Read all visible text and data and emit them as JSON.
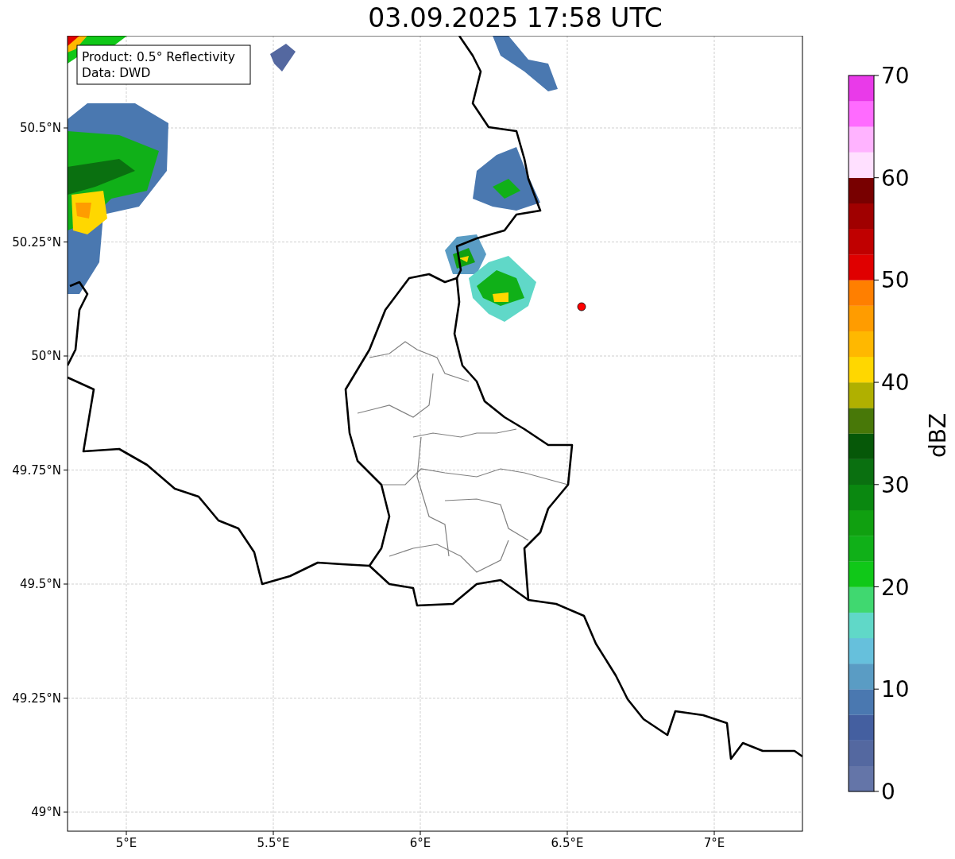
{
  "title": "03.09.2025 17:58 UTC",
  "info_box": [
    "Product: 0.5° Reflectivity",
    "Data: DWD"
  ],
  "x_tick_labels": [
    "5°E",
    "5.5°E",
    "6°E",
    "6.5°E",
    "7°E"
  ],
  "y_tick_labels": [
    "50.5°N",
    "50.25°N",
    "50°N",
    "49.75°N",
    "49.5°N",
    "49.25°N",
    "49°N"
  ],
  "colorbar": {
    "label": "dBZ",
    "tick_labels": [
      "70",
      "60",
      "50",
      "40",
      "30",
      "20",
      "10",
      "0"
    ]
  }
}
